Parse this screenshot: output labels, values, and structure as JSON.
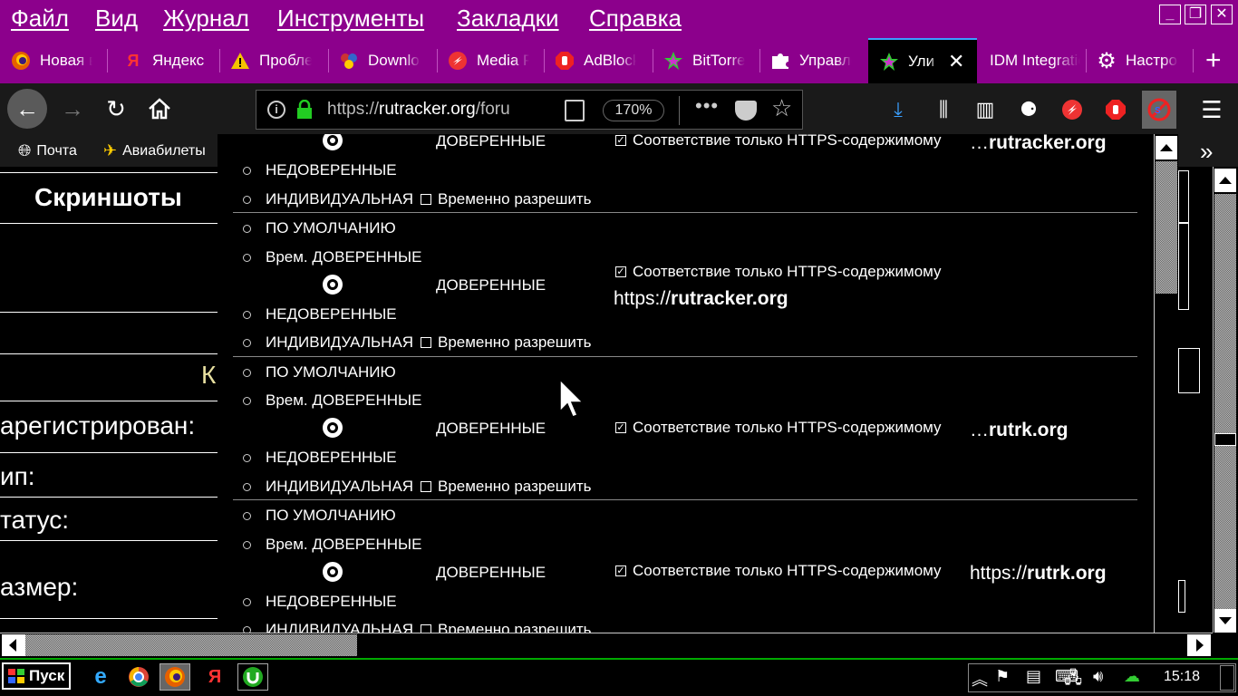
{
  "menubar": {
    "items": [
      "Файл",
      "Вид",
      "Журнал",
      "Инструменты",
      "Закладки",
      "Справка"
    ],
    "controls": [
      "_",
      "❐",
      "✕"
    ]
  },
  "tabs": [
    {
      "label": "Новая вкладка",
      "icon": "firefox-icon"
    },
    {
      "label": "Яндекс",
      "icon": "yandex-icon"
    },
    {
      "label": "Проблемы",
      "icon": "warning-icon"
    },
    {
      "label": "Downloads",
      "icon": "molecule-icon"
    },
    {
      "label": "Media Plus",
      "icon": "media-icon"
    },
    {
      "label": "AdBlock",
      "icon": "adblock-icon"
    },
    {
      "label": "BitTorrent",
      "icon": "star-icon"
    },
    {
      "label": "Управление",
      "icon": "puzzle-icon"
    },
    {
      "label": "Ули",
      "icon": "star-icon",
      "active": true
    },
    {
      "label": "IDM Integration",
      "icon": "none"
    },
    {
      "label": "Настройки",
      "icon": "gear-icon"
    }
  ],
  "navbar": {
    "url_scheme": "https://",
    "url_host": "rutracker.org",
    "url_path": "/foru",
    "zoom": "170%"
  },
  "bookmarks": [
    {
      "label": "Почта",
      "icon": "globe-icon"
    },
    {
      "label": "Авиабилеты",
      "icon": "plane-icon"
    }
  ],
  "page": {
    "title": "Скриншоты",
    "letter_k": "К",
    "labels": [
      "арегистрирован:",
      "ип:",
      "татус:",
      "азмер:"
    ]
  },
  "popup": {
    "labels": {
      "default": "ПО УМОЛЧАНИЮ",
      "temp_trusted": "Врем. ДОВЕРЕННЫЕ",
      "trusted": "ДОВЕРЕННЫЕ",
      "untrusted": "НЕДОВЕРЕННЫЕ",
      "custom": "ИНДИВИДУАЛЬНАЯ",
      "temp_allow": "Временно разрешить",
      "https_only": "Соответствие только HTTPS-содержимому"
    },
    "domains": [
      {
        "prefix": "…",
        "bold": "rutracker.org"
      },
      {
        "prefix": "https://",
        "bold": "rutracker.org"
      },
      {
        "prefix": "…",
        "bold": "rutrk.org"
      },
      {
        "prefix": "https://",
        "bold": "rutrk.org"
      }
    ]
  },
  "taskbar": {
    "start": "Пуск",
    "clock": "15:18"
  }
}
